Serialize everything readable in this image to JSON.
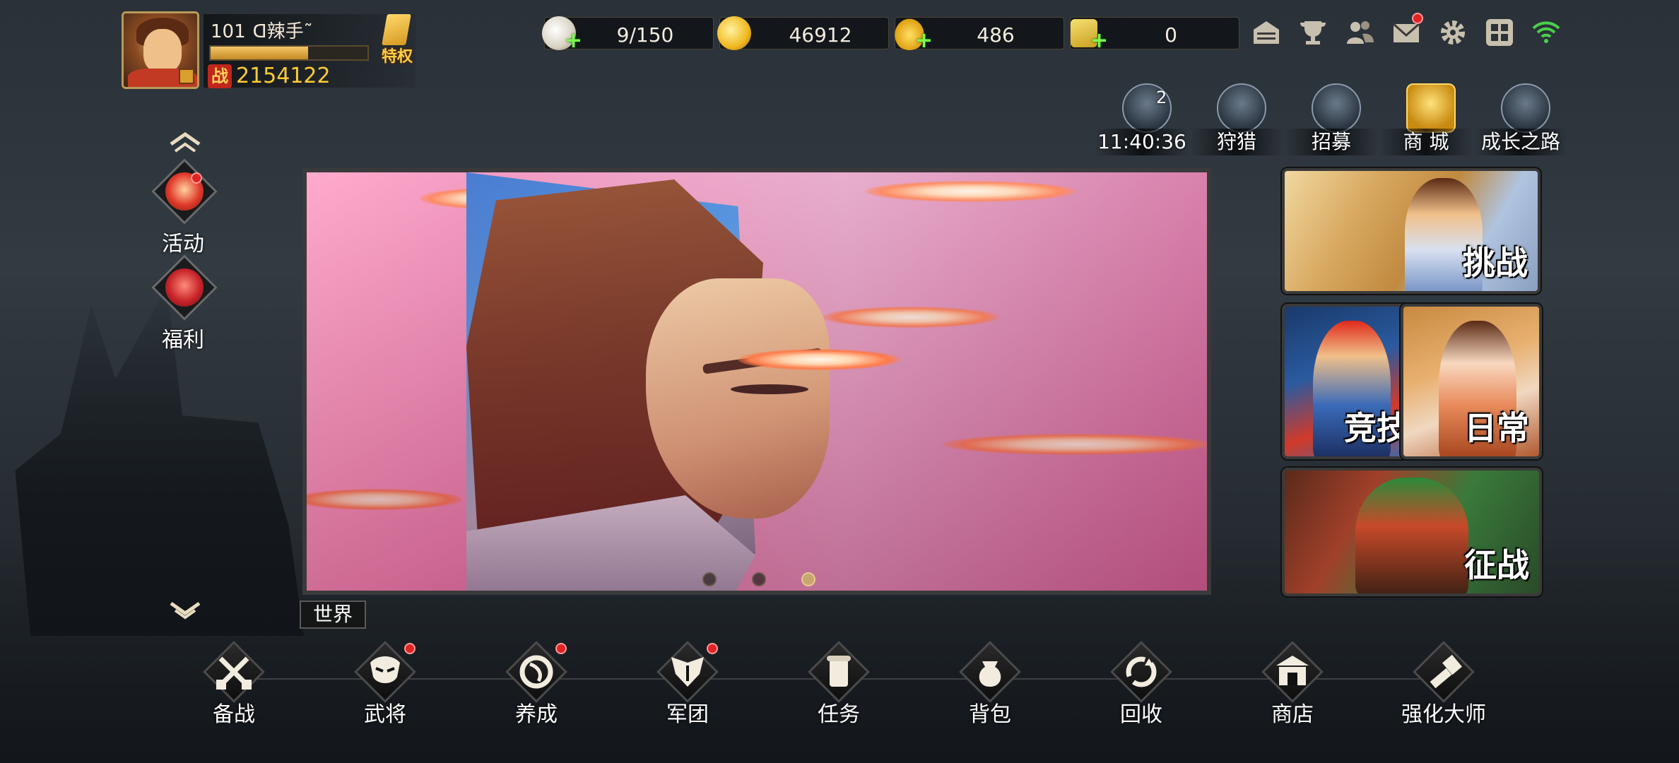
{
  "player": {
    "level": "101",
    "name": "ꓷ辣手˜",
    "exp_fraction": 0.62,
    "power_icon_text": "战",
    "power": "2154122",
    "vip_label": "特权"
  },
  "resources": [
    {
      "id": "stamina",
      "icon": "steamed-bun-icon",
      "value": "9/150"
    },
    {
      "id": "coin",
      "icon": "gold-coin-icon",
      "value": "46912"
    },
    {
      "id": "ingot",
      "icon": "gold-ingot-icon",
      "value": "486"
    },
    {
      "id": "ticket",
      "icon": "ticket-icon",
      "value": "0"
    }
  ],
  "top_icons": [
    "bookshelf-icon",
    "trophy-icon",
    "friends-icon",
    "mail-icon",
    "gear-icon",
    "grid-menu-icon",
    "wifi-icon"
  ],
  "features": [
    {
      "id": "chest",
      "icon": "treasure-chest-icon",
      "badge": "2",
      "label": "11:40:36"
    },
    {
      "id": "hunt",
      "icon": "bow-icon",
      "label": "狩猎"
    },
    {
      "id": "recruit",
      "icon": "dragon-icon",
      "label": "招募"
    },
    {
      "id": "mall",
      "icon": "palace-icon",
      "label": "商 城"
    },
    {
      "id": "growth",
      "icon": "warrior-helmet-icon",
      "label": "成长之路"
    }
  ],
  "side": {
    "activity_label": "活动",
    "welfare_label": "福利"
  },
  "banner": {
    "page_count": 3,
    "active_page": 3
  },
  "world_tab": "世界",
  "cards": {
    "challenge": "挑战",
    "arena": "竞技",
    "daily": "日常",
    "campaign": "征战"
  },
  "bottom_menu": [
    {
      "id": "prepare",
      "icon": "crossed-swords-icon",
      "label": "备战",
      "dot": false
    },
    {
      "id": "generals",
      "icon": "demon-mask-icon",
      "label": "武将",
      "dot": true
    },
    {
      "id": "cultivate",
      "icon": "dragon-scroll-icon",
      "label": "养成",
      "dot": true
    },
    {
      "id": "legion",
      "icon": "winged-crest-icon",
      "label": "军团",
      "dot": true
    },
    {
      "id": "quests",
      "icon": "scroll-icon",
      "label": "任务",
      "dot": false
    },
    {
      "id": "bag",
      "icon": "pouch-icon",
      "label": "背包",
      "dot": false
    },
    {
      "id": "recycle",
      "icon": "recycle-icon",
      "label": "回收",
      "dot": false
    },
    {
      "id": "shop",
      "icon": "shop-icon",
      "label": "商店",
      "dot": false
    },
    {
      "id": "enhance",
      "icon": "hammer-icon",
      "label": "强化大师",
      "dot": false
    }
  ],
  "colors": {
    "accent_gold": "#ffcc33",
    "notification_red": "#e02424",
    "plus_green": "#7cff4a"
  }
}
